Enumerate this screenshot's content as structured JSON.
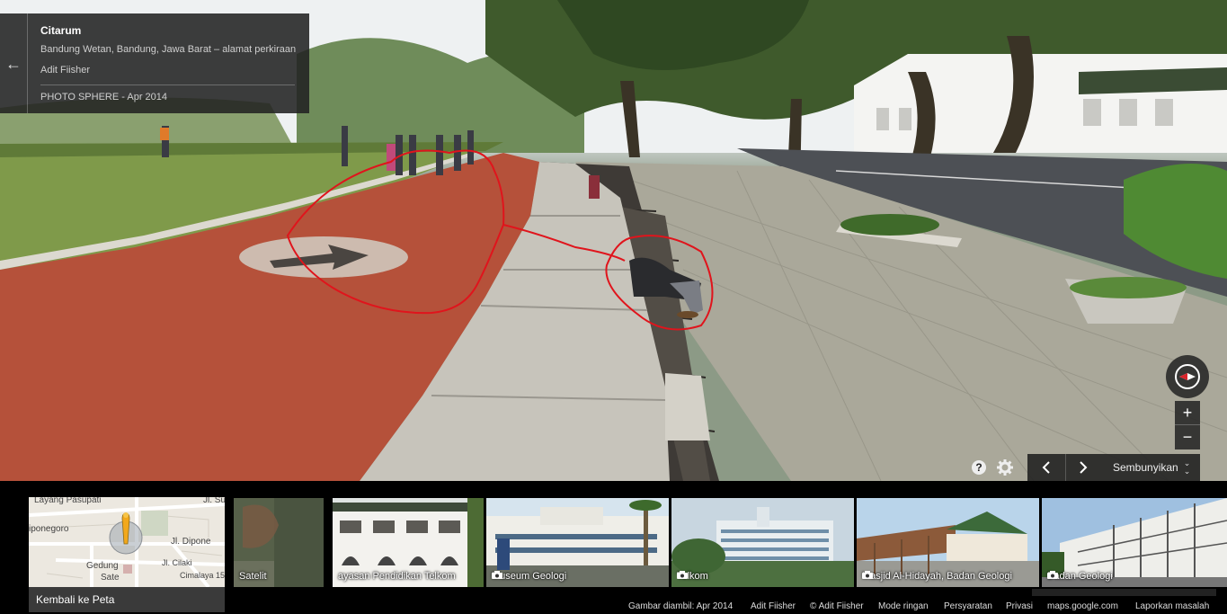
{
  "info_card": {
    "title": "Citarum",
    "address": "Bandung Wetan, Bandung, Jawa Barat – alamat perkiraan",
    "author": "Adit Fiisher",
    "date": "PHOTO SPHERE - Apr 2014"
  },
  "controls": {
    "zoom_in": "+",
    "zoom_out": "−",
    "hide_label": "Sembunyikan"
  },
  "mini_map": {
    "labels": [
      "Layang Pasupati",
      "Jl. Su",
      "iponegoro",
      "Jl. Dipone",
      "Gedung",
      "Sate",
      "Jl. Cilaki",
      "Cimalaya 15"
    ],
    "back_label": "Kembali ke Peta"
  },
  "filmstrip": [
    {
      "label": "Satelit",
      "camera": false
    },
    {
      "label": "ayasan Pendidikan Telkom",
      "camera": false
    },
    {
      "label": "Museum Geologi",
      "camera": true
    },
    {
      "label": "Telkom",
      "camera": true
    },
    {
      "label": "Masjid Al-Hidayah, Badan Geologi",
      "camera": true
    },
    {
      "label": "Badan Geologi",
      "camera": true
    }
  ],
  "footer": {
    "captured": "Gambar diambil: Apr 2014",
    "author": "Adit Fiisher",
    "copyright": "© Adit Fiisher",
    "mode": "Mode ringan",
    "terms": "Persyaratan",
    "privacy": "Privasi",
    "domain": "maps.google.com",
    "report": "Laporkan masalah"
  },
  "colors": {
    "panel_bg": "#222222",
    "track": "#b5513a",
    "annotation": "#e0141c",
    "grass": "#7f9a4a"
  }
}
